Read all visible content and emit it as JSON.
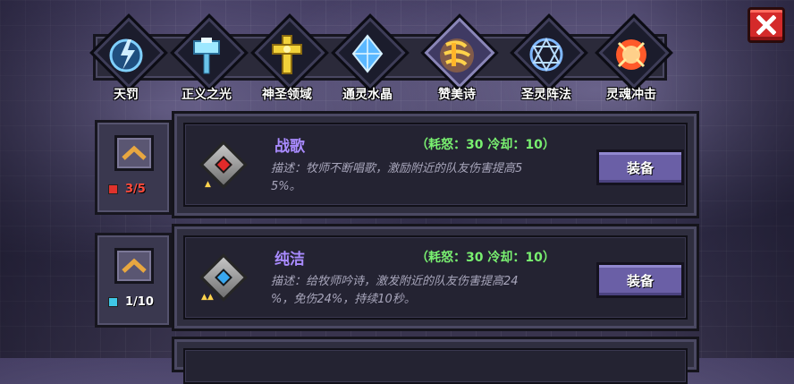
{
  "tabs": [
    {
      "label": "天罚",
      "icon": "lightning-orb-icon"
    },
    {
      "label": "正义之光",
      "icon": "holy-hammer-icon"
    },
    {
      "label": "神圣领域",
      "icon": "golden-cross-icon"
    },
    {
      "label": "通灵水晶",
      "icon": "blue-crystal-icon"
    },
    {
      "label": "赞美诗",
      "icon": "song-wave-icon",
      "active": true
    },
    {
      "label": "圣灵阵法",
      "icon": "magic-circle-icon"
    },
    {
      "label": "灵魂冲击",
      "icon": "soul-burst-icon"
    }
  ],
  "close_icon": "close-x-icon",
  "skills": [
    {
      "name": "战歌",
      "cost": "（耗怒：30  冷却：10）",
      "desc_line1": "描述：牧师不断唱歌，激励附近的队友伤害提高5",
      "desc_line2": "5%。",
      "level": "3/5",
      "gem_color": "#e0322c",
      "core_color": "#e02a2a",
      "stars": "▲",
      "equip_label": "装备"
    },
    {
      "name": "纯洁",
      "cost": "（耗怒：30  冷却：10）",
      "desc_line1": "描述：给牧师吟诗，激发附近的队友伤害提高24",
      "desc_line2": "%，免伤24%，持续10秒。",
      "level": "1/10",
      "gem_color": "#3fc7e6",
      "core_color": "#38a8f0",
      "stars": "▲▲",
      "equip_label": "装备"
    },
    {
      "name": "",
      "cost": "",
      "desc_line1": "",
      "desc_line2": "",
      "level": "",
      "equip_label": ""
    }
  ],
  "colors": {
    "accent_name": "#a98bff",
    "cost_green": "#79f070",
    "button_purple": "#6a5fa6",
    "close_red": "#d42a2a"
  }
}
